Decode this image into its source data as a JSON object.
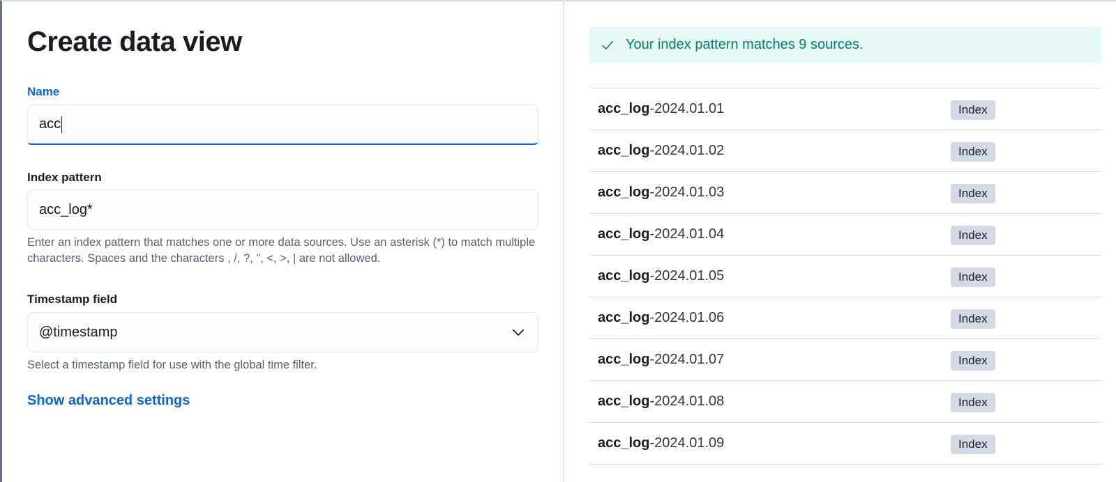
{
  "page": {
    "title": "Create data view"
  },
  "form": {
    "name": {
      "label": "Name",
      "value": "acc"
    },
    "index_pattern": {
      "label": "Index pattern",
      "value": "acc_log*",
      "help": "Enter an index pattern that matches one or more data sources. Use an asterisk (*) to match multiple characters. Spaces and the characters , /, ?, \", <, >, | are not allowed."
    },
    "timestamp_field": {
      "label": "Timestamp field",
      "value": "@timestamp",
      "help": "Select a timestamp field for use with the global time filter."
    },
    "advanced_link": "Show advanced settings"
  },
  "results": {
    "callout": "Your index pattern matches 9 sources.",
    "rows": [
      {
        "match": "acc_log",
        "rest": "-2024.01.01",
        "type": "Index"
      },
      {
        "match": "acc_log",
        "rest": "-2024.01.02",
        "type": "Index"
      },
      {
        "match": "acc_log",
        "rest": "-2024.01.03",
        "type": "Index"
      },
      {
        "match": "acc_log",
        "rest": "-2024.01.04",
        "type": "Index"
      },
      {
        "match": "acc_log",
        "rest": "-2024.01.05",
        "type": "Index"
      },
      {
        "match": "acc_log",
        "rest": "-2024.01.06",
        "type": "Index"
      },
      {
        "match": "acc_log",
        "rest": "-2024.01.07",
        "type": "Index"
      },
      {
        "match": "acc_log",
        "rest": "-2024.01.08",
        "type": "Index"
      },
      {
        "match": "acc_log",
        "rest": "-2024.01.09",
        "type": "Index"
      }
    ]
  },
  "colors": {
    "accent": "#0b64dd",
    "success_text": "#00806f",
    "success_bg": "#e6f9f6",
    "badge_bg": "#d3dae6"
  },
  "icons": {
    "callout": "check-icon",
    "select": "chevron-down-icon"
  }
}
